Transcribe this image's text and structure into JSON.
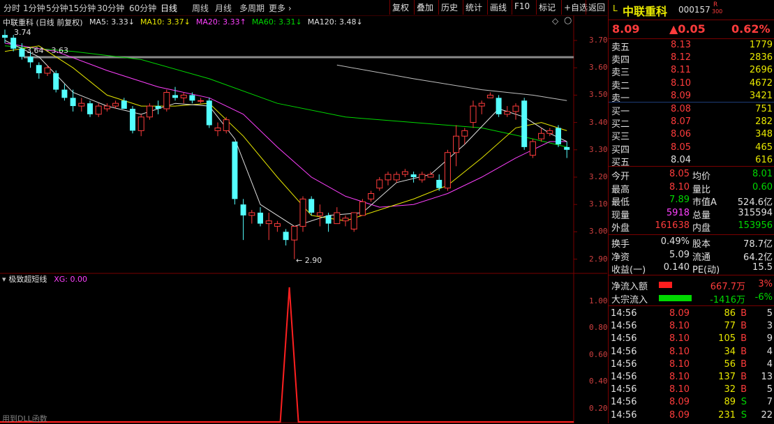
{
  "toolbar": {
    "periods": [
      "分时",
      "1分钟",
      "5分钟",
      "15分钟",
      "30分钟",
      "60分钟",
      "日线",
      "周线",
      "月线",
      "多周期",
      "更多 ›"
    ],
    "active_period": "日线",
    "right_buttons": [
      "复权",
      "叠加",
      "历史",
      "统计",
      "画线",
      "F10",
      "标记",
      "+自选",
      "返回"
    ]
  },
  "chart": {
    "title": "中联重科 (日线 前复权)",
    "ma": [
      {
        "label": "MA5: 3.33",
        "arrow": "↓",
        "color": "#e0e0e0"
      },
      {
        "label": "MA10: 3.37",
        "arrow": "↓",
        "color": "#e8e800"
      },
      {
        "label": "MA20: 3.33",
        "arrow": "↑",
        "color": "#ff40ff"
      },
      {
        "label": "MA60: 3.31",
        "arrow": "↓",
        "color": "#00d800"
      },
      {
        "label": "MA120: 3.48",
        "arrow": "↓",
        "color": "#e0e0e0"
      }
    ],
    "price_axis": [
      "3.70",
      "3.60",
      "3.50",
      "3.40",
      "3.30",
      "3.20",
      "3.10",
      "3.00",
      "2.90"
    ],
    "annotations": {
      "high": "3.74",
      "range": "3.64 - 3.63",
      "low": "← 2.90"
    },
    "indicator_title": "极致超短线",
    "indicator_value": "XG: 0.00",
    "indicator_axis": [
      "1.00",
      "0.80",
      "0.60",
      "0.40",
      "0.20"
    ],
    "footer": "用到DLL函数",
    "colors": {
      "up": "#ff3c3c",
      "down": "#54ffff",
      "ma5": "#e0e0e0",
      "ma10": "#e8e800",
      "ma20": "#ff40ff",
      "ma60": "#00d800",
      "ma120": "#c0c0c0"
    }
  },
  "quote": {
    "market_flag": "L",
    "name": "中联重科",
    "code": "000157",
    "badge_top": "R",
    "badge_bottom": "300",
    "price": "8.09",
    "change": "▲0.05",
    "pct": "0.62%",
    "asks": [
      {
        "label": "卖五",
        "price": "8.13",
        "vol": "1779"
      },
      {
        "label": "卖四",
        "price": "8.12",
        "vol": "2836"
      },
      {
        "label": "卖三",
        "price": "8.11",
        "vol": "2696"
      },
      {
        "label": "卖二",
        "price": "8.10",
        "vol": "4672"
      },
      {
        "label": "卖一",
        "price": "8.09",
        "vol": "3421"
      }
    ],
    "bids": [
      {
        "label": "买一",
        "price": "8.08",
        "vol": "751"
      },
      {
        "label": "买二",
        "price": "8.07",
        "vol": "282"
      },
      {
        "label": "买三",
        "price": "8.06",
        "vol": "348"
      },
      {
        "label": "买四",
        "price": "8.05",
        "vol": "465"
      },
      {
        "label": "买五",
        "price": "8.04",
        "vol": "616"
      }
    ],
    "stats": [
      {
        "l1": "今开",
        "v1": "8.05",
        "c1": "up",
        "l2": "均价",
        "v2": "8.01",
        "c2": "dn"
      },
      {
        "l1": "最高",
        "v1": "8.10",
        "c1": "up",
        "l2": "量比",
        "v2": "0.60",
        "c2": "dn"
      },
      {
        "l1": "最低",
        "v1": "7.89",
        "c1": "dn",
        "l2": "市值A",
        "v2": "524.6亿",
        "c2": "wh"
      },
      {
        "l1": "现量",
        "v1": "5918",
        "c1": "mg",
        "l2": "总量",
        "v2": "315594",
        "c2": "wh"
      },
      {
        "l1": "外盘",
        "v1": "161638",
        "c1": "up",
        "l2": "内盘",
        "v2": "153956",
        "c2": "dn"
      }
    ],
    "fund": [
      {
        "l1": "换手",
        "v1": "0.49%",
        "l2": "股本",
        "v2": "78.7亿"
      },
      {
        "l1": "净资",
        "v1": "5.09",
        "l2": "流通",
        "v2": "64.2亿"
      },
      {
        "l1": "收益(一)",
        "v1": "0.140",
        "l2": "PE(动)",
        "v2": "15.5"
      }
    ],
    "flows": [
      {
        "label": "净流入额",
        "value": "667.7万",
        "pct": "3%",
        "bar_color": "#ff1e1e",
        "bar_fill": 0.35,
        "cls": "up"
      },
      {
        "label": "大宗流入",
        "value": "-1416万",
        "pct": "-6%",
        "bar_color": "#00d800",
        "bar_fill": 0.85,
        "cls": "dn"
      }
    ],
    "ticks": [
      {
        "time": "14:56",
        "price": "8.09",
        "vol": "86",
        "side": "B",
        "n": "5"
      },
      {
        "time": "14:56",
        "price": "8.10",
        "vol": "77",
        "side": "B",
        "n": "3"
      },
      {
        "time": "14:56",
        "price": "8.10",
        "vol": "105",
        "side": "B",
        "n": "9"
      },
      {
        "time": "14:56",
        "price": "8.10",
        "vol": "34",
        "side": "B",
        "n": "4"
      },
      {
        "time": "14:56",
        "price": "8.10",
        "vol": "56",
        "side": "B",
        "n": "4"
      },
      {
        "time": "14:56",
        "price": "8.10",
        "vol": "137",
        "side": "B",
        "n": "13"
      },
      {
        "time": "14:56",
        "price": "8.10",
        "vol": "32",
        "side": "B",
        "n": "5"
      },
      {
        "time": "14:56",
        "price": "8.09",
        "vol": "89",
        "side": "S",
        "n": "7"
      },
      {
        "time": "14:56",
        "price": "8.09",
        "vol": "231",
        "side": "S",
        "n": "22"
      }
    ]
  },
  "chart_data": {
    "type": "candlestick",
    "title": "中联重科 (日线 前复权)",
    "ylim": [
      2.87,
      3.74
    ],
    "candles": [
      [
        3.72,
        3.74,
        3.69,
        3.71
      ],
      [
        3.71,
        3.72,
        3.66,
        3.67
      ],
      [
        3.67,
        3.69,
        3.63,
        3.64
      ],
      [
        3.64,
        3.66,
        3.6,
        3.62
      ],
      [
        3.61,
        3.62,
        3.56,
        3.58
      ],
      [
        3.58,
        3.61,
        3.57,
        3.6
      ],
      [
        3.58,
        3.59,
        3.51,
        3.52
      ],
      [
        3.52,
        3.54,
        3.48,
        3.49
      ],
      [
        3.49,
        3.52,
        3.44,
        3.46
      ],
      [
        3.46,
        3.49,
        3.44,
        3.47
      ],
      [
        3.47,
        3.48,
        3.42,
        3.43
      ],
      [
        3.43,
        3.47,
        3.42,
        3.46
      ],
      [
        3.45,
        3.47,
        3.44,
        3.46
      ],
      [
        3.46,
        3.48,
        3.45,
        3.47
      ],
      [
        3.48,
        3.49,
        3.45,
        3.45
      ],
      [
        3.45,
        3.46,
        3.36,
        3.37
      ],
      [
        3.37,
        3.43,
        3.35,
        3.42
      ],
      [
        3.42,
        3.47,
        3.41,
        3.46
      ],
      [
        3.46,
        3.48,
        3.43,
        3.45
      ],
      [
        3.45,
        3.52,
        3.44,
        3.51
      ],
      [
        3.5,
        3.53,
        3.48,
        3.49
      ],
      [
        3.49,
        3.51,
        3.47,
        3.5
      ],
      [
        3.5,
        3.51,
        3.47,
        3.48
      ],
      [
        3.48,
        3.49,
        3.47,
        3.48
      ],
      [
        3.48,
        3.49,
        3.38,
        3.39
      ],
      [
        3.37,
        3.4,
        3.35,
        3.38
      ],
      [
        3.37,
        3.42,
        3.36,
        3.41
      ],
      [
        3.33,
        3.33,
        3.1,
        3.12
      ],
      [
        3.1,
        3.12,
        2.97,
        3.06
      ],
      [
        3.06,
        3.08,
        3.03,
        3.07
      ],
      [
        3.07,
        3.09,
        3.02,
        3.03
      ],
      [
        3.03,
        3.07,
        2.97,
        3.04
      ],
      [
        3.02,
        3.04,
        3.0,
        3.03
      ],
      [
        3.0,
        3.01,
        2.95,
        2.97
      ],
      [
        2.97,
        3.02,
        2.9,
        3.02
      ],
      [
        3.02,
        3.13,
        3.0,
        3.12
      ],
      [
        3.12,
        3.13,
        3.06,
        3.07
      ],
      [
        3.06,
        3.1,
        3.02,
        3.07
      ],
      [
        3.06,
        3.07,
        3.0,
        3.03
      ],
      [
        3.03,
        3.09,
        3.03,
        3.07
      ],
      [
        3.04,
        3.06,
        3.02,
        3.05
      ],
      [
        3.01,
        3.07,
        3.0,
        3.07
      ],
      [
        3.06,
        3.12,
        3.06,
        3.11
      ],
      [
        3.12,
        3.15,
        3.11,
        3.14
      ],
      [
        3.16,
        3.2,
        3.15,
        3.19
      ],
      [
        3.19,
        3.22,
        3.17,
        3.21
      ],
      [
        3.19,
        3.22,
        3.18,
        3.21
      ],
      [
        3.21,
        3.23,
        3.2,
        3.22
      ],
      [
        3.21,
        3.22,
        3.18,
        3.2
      ],
      [
        3.19,
        3.22,
        3.18,
        3.21
      ],
      [
        3.2,
        3.22,
        3.2,
        3.21
      ],
      [
        3.19,
        3.21,
        3.15,
        3.16
      ],
      [
        3.16,
        3.3,
        3.15,
        3.29
      ],
      [
        3.29,
        3.39,
        3.24,
        3.35
      ],
      [
        3.35,
        3.38,
        3.32,
        3.37
      ],
      [
        3.4,
        3.48,
        3.38,
        3.46
      ],
      [
        3.46,
        3.48,
        3.43,
        3.47
      ],
      [
        3.49,
        3.51,
        3.49,
        3.5
      ],
      [
        3.49,
        3.5,
        3.42,
        3.43
      ],
      [
        3.43,
        3.46,
        3.42,
        3.44
      ],
      [
        3.44,
        3.47,
        3.41,
        3.46
      ],
      [
        3.48,
        3.49,
        3.3,
        3.31
      ],
      [
        3.28,
        3.34,
        3.27,
        3.33
      ],
      [
        3.34,
        3.38,
        3.33,
        3.36
      ],
      [
        3.36,
        3.38,
        3.35,
        3.37
      ],
      [
        3.38,
        3.39,
        3.31,
        3.32
      ],
      [
        3.31,
        3.33,
        3.27,
        3.3
      ]
    ],
    "ma5": [
      [
        0,
        3.7
      ],
      [
        4,
        3.64
      ],
      [
        8,
        3.51
      ],
      [
        12,
        3.46
      ],
      [
        16,
        3.43
      ],
      [
        20,
        3.47
      ],
      [
        24,
        3.46
      ],
      [
        27,
        3.34
      ],
      [
        30,
        3.1
      ],
      [
        34,
        3.02
      ],
      [
        38,
        3.06
      ],
      [
        42,
        3.07
      ],
      [
        46,
        3.18
      ],
      [
        50,
        3.21
      ],
      [
        54,
        3.32
      ],
      [
        58,
        3.45
      ],
      [
        61,
        3.42
      ],
      [
        64,
        3.36
      ],
      [
        66,
        3.33
      ]
    ],
    "ma10": [
      [
        0,
        3.66
      ],
      [
        4,
        3.68
      ],
      [
        8,
        3.6
      ],
      [
        12,
        3.5
      ],
      [
        16,
        3.46
      ],
      [
        20,
        3.46
      ],
      [
        24,
        3.47
      ],
      [
        28,
        3.35
      ],
      [
        32,
        3.2
      ],
      [
        36,
        3.06
      ],
      [
        40,
        3.04
      ],
      [
        44,
        3.08
      ],
      [
        48,
        3.12
      ],
      [
        52,
        3.17
      ],
      [
        56,
        3.27
      ],
      [
        60,
        3.38
      ],
      [
        63,
        3.4
      ],
      [
        66,
        3.37
      ]
    ],
    "ma20": [
      [
        0,
        3.69
      ],
      [
        6,
        3.66
      ],
      [
        12,
        3.59
      ],
      [
        18,
        3.53
      ],
      [
        24,
        3.49
      ],
      [
        28,
        3.43
      ],
      [
        32,
        3.31
      ],
      [
        36,
        3.2
      ],
      [
        40,
        3.13
      ],
      [
        44,
        3.09
      ],
      [
        48,
        3.1
      ],
      [
        52,
        3.14
      ],
      [
        56,
        3.2
      ],
      [
        60,
        3.27
      ],
      [
        64,
        3.33
      ],
      [
        66,
        3.33
      ]
    ],
    "ma60": [
      [
        0,
        3.68
      ],
      [
        8,
        3.66
      ],
      [
        16,
        3.63
      ],
      [
        24,
        3.56
      ],
      [
        32,
        3.47
      ],
      [
        40,
        3.42
      ],
      [
        48,
        3.4
      ],
      [
        56,
        3.38
      ],
      [
        62,
        3.34
      ],
      [
        66,
        3.31
      ]
    ],
    "ma120": [
      [
        39,
        3.61
      ],
      [
        48,
        3.56
      ],
      [
        56,
        3.52
      ],
      [
        62,
        3.5
      ],
      [
        66,
        3.48
      ]
    ],
    "indicator": {
      "name": "XG",
      "spike_index": 33,
      "values_range": [
        0,
        1
      ]
    }
  }
}
